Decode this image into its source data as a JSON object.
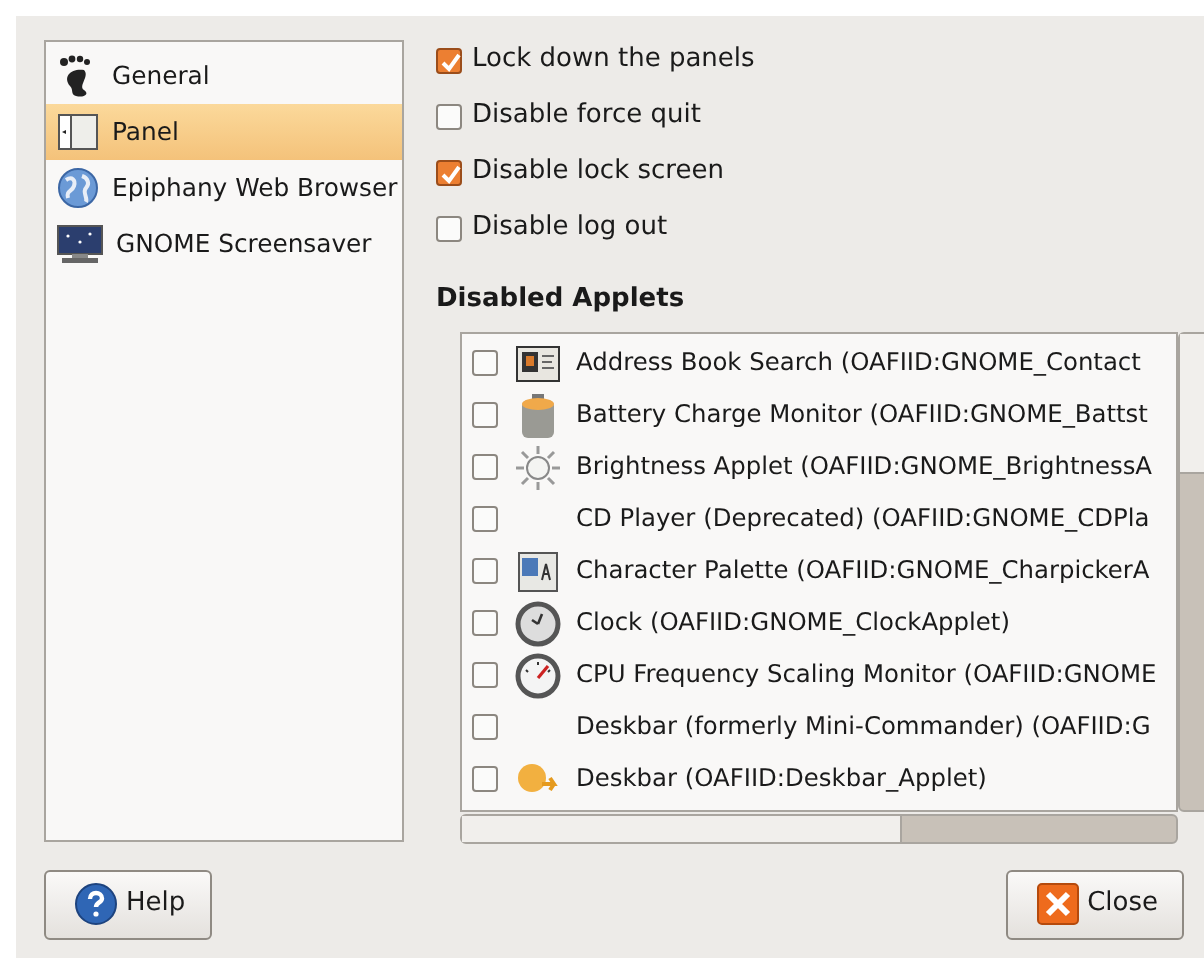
{
  "sidebar": {
    "items": [
      {
        "label": "General",
        "kind": "foot",
        "selected": false
      },
      {
        "label": "Panel",
        "kind": "panel",
        "selected": true
      },
      {
        "label": "Epiphany Web Browser",
        "kind": "globe",
        "selected": false
      },
      {
        "label": "GNOME Screensaver",
        "kind": "monitor",
        "selected": false
      }
    ]
  },
  "options": [
    {
      "label": "Lock down the panels",
      "checked": true
    },
    {
      "label": "Disable force quit",
      "checked": false
    },
    {
      "label": "Disable lock screen",
      "checked": true
    },
    {
      "label": "Disable log out",
      "checked": false
    }
  ],
  "disabled_applets": {
    "heading": "Disabled Applets",
    "items": [
      {
        "label": "Address Book Search (OAFIID:GNOME_Contact",
        "kind": "card",
        "checked": false
      },
      {
        "label": "Battery Charge Monitor (OAFIID:GNOME_Battst",
        "kind": "battery",
        "checked": false
      },
      {
        "label": "Brightness Applet (OAFIID:GNOME_BrightnessA",
        "kind": "sun",
        "checked": false
      },
      {
        "label": "CD Player (Deprecated) (OAFIID:GNOME_CDPla",
        "kind": "plain",
        "checked": false
      },
      {
        "label": "Character Palette (OAFIID:GNOME_CharpickerA",
        "kind": "charmap",
        "checked": false
      },
      {
        "label": "Clock (OAFIID:GNOME_ClockApplet)",
        "kind": "clock",
        "checked": false
      },
      {
        "label": "CPU Frequency Scaling Monitor (OAFIID:GNOME",
        "kind": "gauge",
        "checked": false
      },
      {
        "label": "Deskbar (formerly Mini-Commander) (OAFIID:G",
        "kind": "plain",
        "checked": false
      },
      {
        "label": "Deskbar (OAFIID:Deskbar_Applet)",
        "kind": "deskbar",
        "checked": false
      }
    ]
  },
  "buttons": [
    {
      "label": "Help",
      "kind": "help"
    },
    {
      "label": "Close",
      "kind": "close"
    }
  ]
}
